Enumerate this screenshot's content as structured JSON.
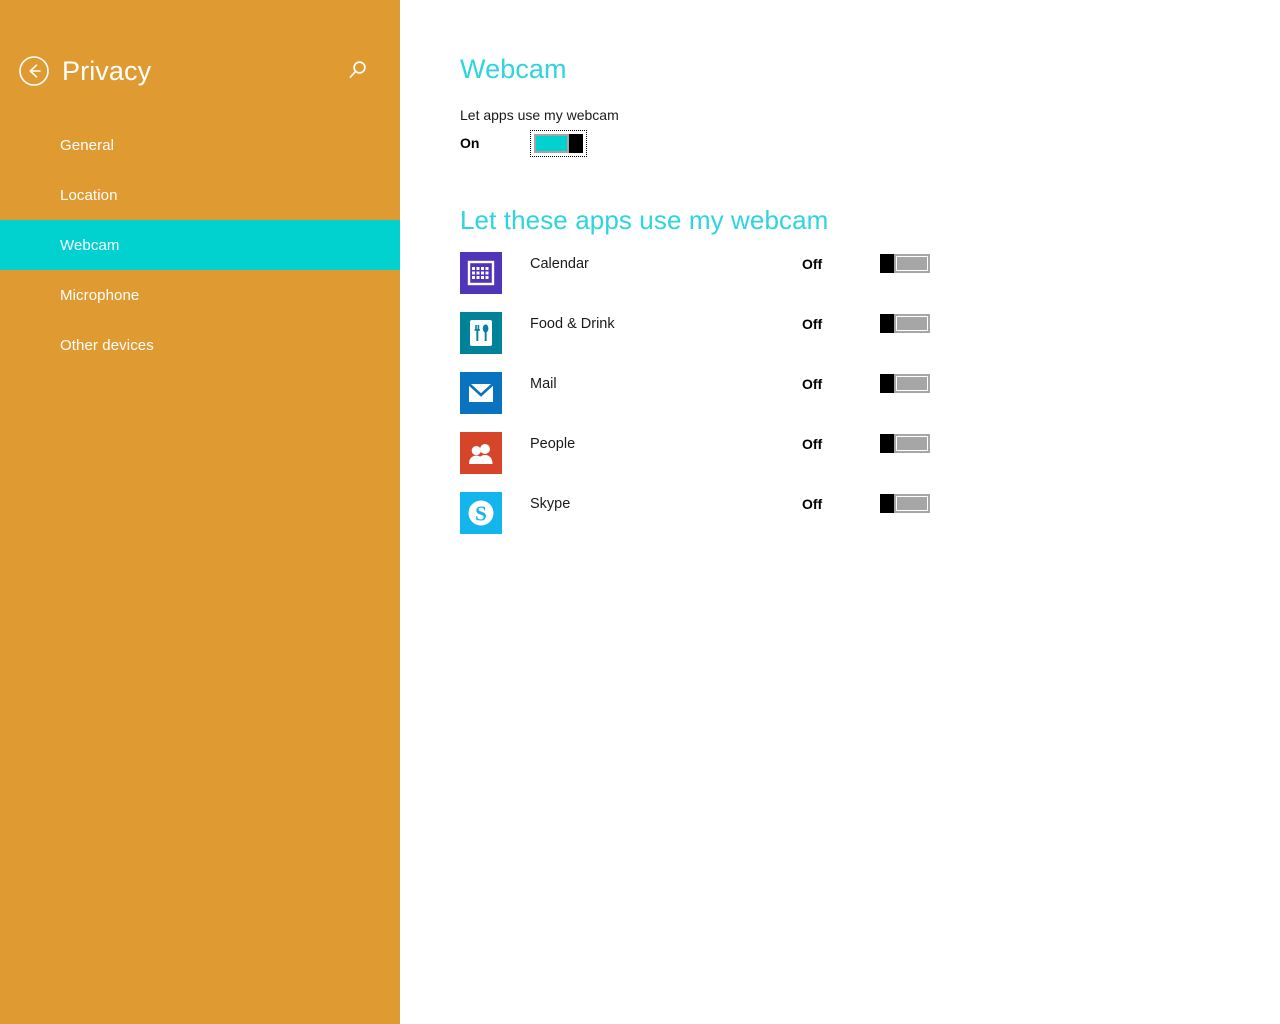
{
  "sidebar": {
    "title": "Privacy",
    "back_icon": "back-arrow-circle-icon",
    "search_icon": "search-icon",
    "background_color": "#e09a32",
    "selected_color": "#01d2cf",
    "items": [
      {
        "label": "General",
        "selected": false
      },
      {
        "label": "Location",
        "selected": false
      },
      {
        "label": "Webcam",
        "selected": true
      },
      {
        "label": "Microphone",
        "selected": false
      },
      {
        "label": "Other devices",
        "selected": false
      }
    ]
  },
  "main": {
    "title": "Webcam",
    "heading_color": "#2ed4de",
    "master_setting": {
      "label": "Let apps use my webcam",
      "state": "On",
      "enabled": true,
      "focused": true
    },
    "apps_section": {
      "heading": "Let these apps use my webcam",
      "apps": [
        {
          "name": "Calendar",
          "state": "Off",
          "enabled": false,
          "icon": "calendar-app-icon",
          "icon_color": "#4f35ba"
        },
        {
          "name": "Food & Drink",
          "state": "Off",
          "enabled": false,
          "icon": "food-drink-app-icon",
          "icon_color": "#008299"
        },
        {
          "name": "Mail",
          "state": "Off",
          "enabled": false,
          "icon": "mail-app-icon",
          "icon_color": "#0a73c0"
        },
        {
          "name": "People",
          "state": "Off",
          "enabled": false,
          "icon": "people-app-icon",
          "icon_color": "#d6442a"
        },
        {
          "name": "Skype",
          "state": "Off",
          "enabled": false,
          "icon": "skype-app-icon",
          "icon_color": "#14b5ec"
        }
      ]
    }
  }
}
